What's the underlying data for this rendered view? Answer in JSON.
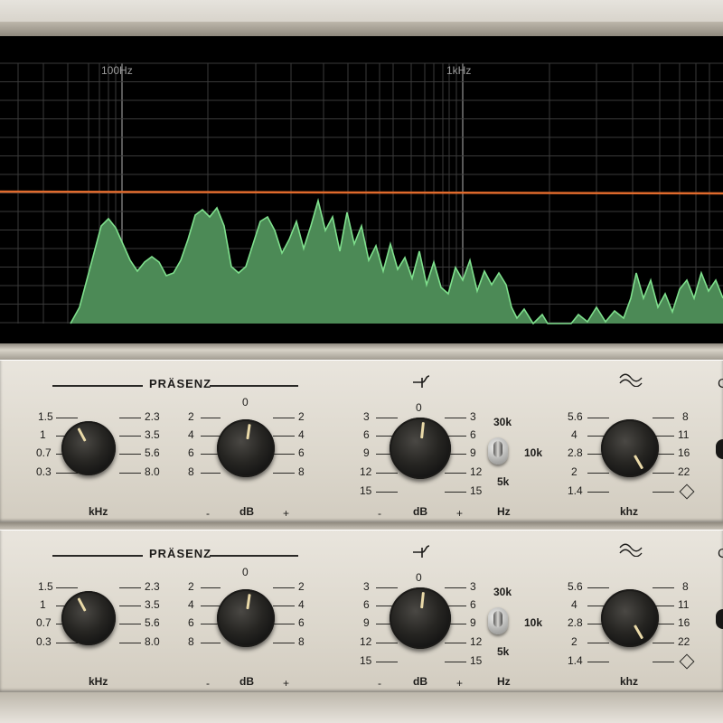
{
  "analyzer": {
    "freq_labels": [
      "100Hz",
      "1kHz"
    ],
    "colors": {
      "curve": "#e06a2c",
      "spectrum_fill": "#4c8a56",
      "spectrum_line": "#7fe08d",
      "grid": "#3b3b3b"
    }
  },
  "bands": [
    {
      "presenz": {
        "title": "PRÄSENZ",
        "freq_left": [
          "1.5",
          "1",
          "0.7",
          "0.3"
        ],
        "freq_right": [
          "2.3",
          "3.5",
          "5.6",
          "8.0"
        ],
        "freq_unit": "kHz",
        "gain_left": [
          "2",
          "4",
          "6",
          "8"
        ],
        "gain_top": "0",
        "gain_right": [
          "2",
          "4",
          "6",
          "8"
        ],
        "gain_minus": "-",
        "gain_unit": "dB",
        "gain_plus": "+"
      },
      "shelf": {
        "icon": "high-shelf-icon",
        "top": "0",
        "left": [
          "3",
          "6",
          "9",
          "12",
          "15"
        ],
        "right": [
          "3",
          "6",
          "9",
          "12",
          "15"
        ],
        "minus": "-",
        "unit": "dB",
        "plus": "+"
      },
      "switch": {
        "labels": [
          "30k",
          "10k",
          "5k"
        ],
        "unit": "Hz"
      },
      "filter": {
        "icon": "lowpass-icon",
        "left": [
          "5.6",
          "4",
          "2.8",
          "2",
          "1.4"
        ],
        "right": [
          "8",
          "11",
          "16",
          "22"
        ],
        "unit": "khz"
      },
      "edge_letter": "C"
    },
    {
      "presenz": {
        "title": "PRÄSENZ",
        "freq_left": [
          "1.5",
          "1",
          "0.7",
          "0.3"
        ],
        "freq_right": [
          "2.3",
          "3.5",
          "5.6",
          "8.0"
        ],
        "freq_unit": "kHz",
        "gain_left": [
          "2",
          "4",
          "6",
          "8"
        ],
        "gain_top": "0",
        "gain_right": [
          "2",
          "4",
          "6",
          "8"
        ],
        "gain_minus": "-",
        "gain_unit": "dB",
        "gain_plus": "+"
      },
      "shelf": {
        "icon": "high-shelf-icon",
        "top": "0",
        "left": [
          "3",
          "6",
          "9",
          "12",
          "15"
        ],
        "right": [
          "3",
          "6",
          "9",
          "12",
          "15"
        ],
        "minus": "-",
        "unit": "dB",
        "plus": "+"
      },
      "switch": {
        "labels": [
          "30k",
          "10k",
          "5k"
        ],
        "unit": "Hz"
      },
      "filter": {
        "icon": "lowpass-icon",
        "left": [
          "5.6",
          "4",
          "2.8",
          "2",
          "1.4"
        ],
        "right": [
          "8",
          "11",
          "16",
          "22"
        ],
        "unit": "khz"
      },
      "edge_letter": "C"
    }
  ]
}
